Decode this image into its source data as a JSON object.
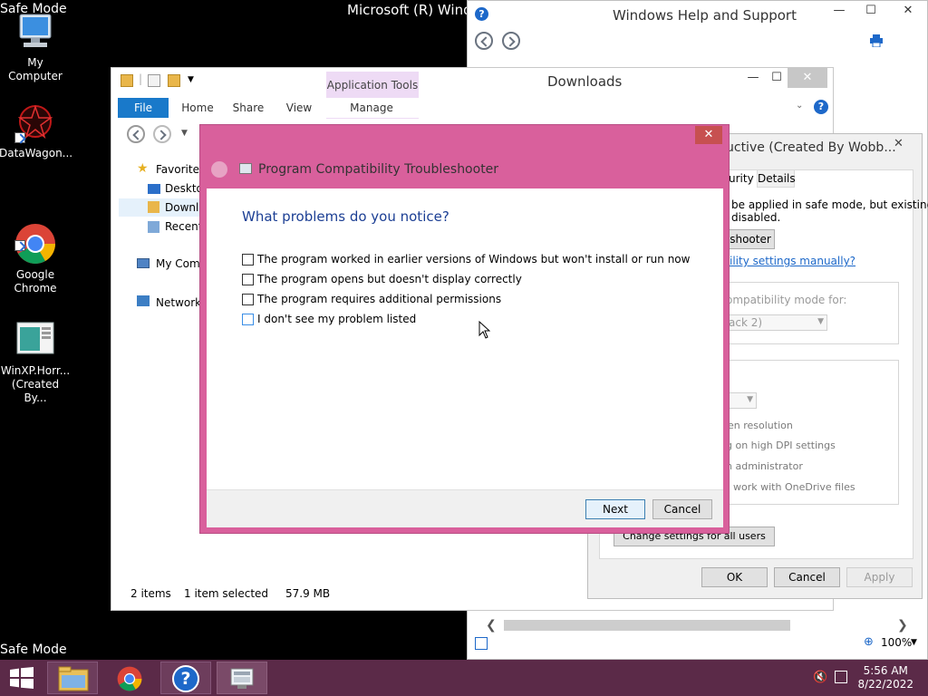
{
  "desktop": {
    "safe_mode_top": "Safe Mode",
    "safe_mode_bottom": "Safe Mode",
    "title_text": "Microsoft (R) Windo",
    "icons": [
      {
        "label": "My Computer",
        "icon": "computer-icon"
      },
      {
        "label": "DataWagon...",
        "icon": "datawagon-icon"
      },
      {
        "label": "Google\nChrome",
        "icon": "chrome-icon"
      },
      {
        "label": "WinXP.Horr...\n(Created By...",
        "icon": "document-icon"
      }
    ]
  },
  "help_window": {
    "title": "Windows Help and Support",
    "zoom": "100%"
  },
  "explorer": {
    "title": "Downloads",
    "context_tab": "Application Tools",
    "tabs": [
      "File",
      "Home",
      "Share",
      "View",
      "Manage"
    ],
    "nav": {
      "favorites": "Favorites",
      "desktop": "Desktop",
      "downloads": "Downlo",
      "recent": "Recent",
      "my_computer": "My Comp",
      "network": "Network"
    },
    "status": {
      "items": "2 items",
      "selected": "1 item selected",
      "size": "57.9 MB"
    }
  },
  "properties": {
    "title": "uctive  (Created By Wobb...",
    "tabs": [
      "urity",
      "Details"
    ],
    "info_line1": "be applied in safe mode, but existing",
    "info_line2": "disabled.",
    "troubleshoot_button": "shooter",
    "manual_link": "ility settings manually?",
    "compat_mode_label": "ompatibility mode for:",
    "compat_mode_value": "ack 2)",
    "options": [
      "en resolution",
      "g on high DPI settings",
      "n administrator",
      "work with OneDrive files"
    ],
    "all_users_button": "Change settings for all users",
    "ok": "OK",
    "cancel": "Cancel",
    "apply": "Apply"
  },
  "dialog": {
    "title": "Program Compatibility Troubleshooter",
    "heading": "What problems do you notice?",
    "options": [
      "The program worked in earlier versions of Windows but won't install or run now",
      "The program opens but doesn't display correctly",
      "The program requires additional permissions",
      "I don't see my problem listed"
    ],
    "next": "Next",
    "cancel": "Cancel",
    "close": "✕"
  },
  "taskbar": {
    "time": "5:56 AM",
    "date": "8/22/2022"
  },
  "colors": {
    "dialog_frame": "#d9609c",
    "taskbar": "#5b2a48",
    "heading": "#1c3f94",
    "file_tab": "#1979ca"
  }
}
